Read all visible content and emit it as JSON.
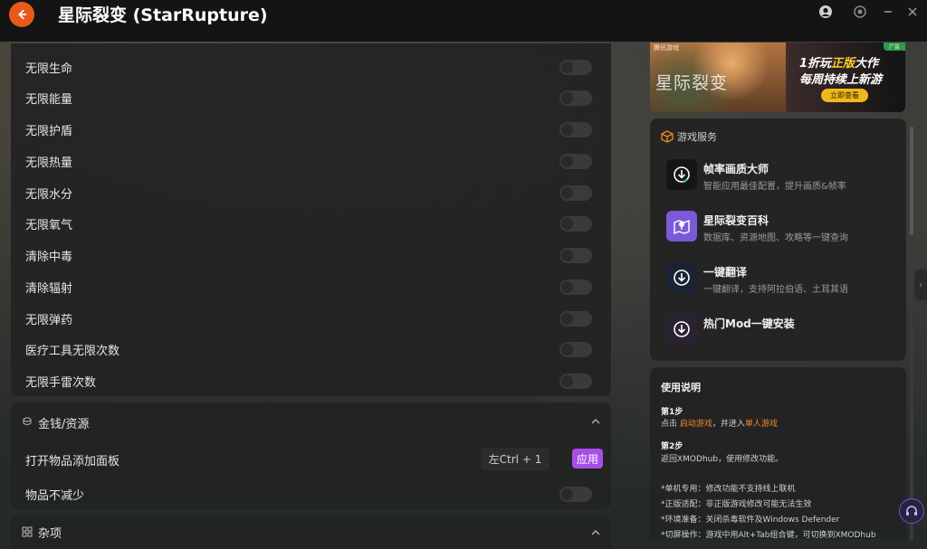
{
  "header": {
    "title": "星际裂变 (StarRupture)"
  },
  "cheats": {
    "items": [
      {
        "label": "无限生命"
      },
      {
        "label": "无限能量"
      },
      {
        "label": "无限护盾"
      },
      {
        "label": "无限热量"
      },
      {
        "label": "无限水分"
      },
      {
        "label": "无限氧气"
      },
      {
        "label": "清除中毒"
      },
      {
        "label": "清除辐射"
      },
      {
        "label": "无限弹药"
      },
      {
        "label": "医疗工具无限次数"
      },
      {
        "label": "无限手雷次数"
      }
    ]
  },
  "money_section": {
    "title": "金钱/资源",
    "open_panel_label": "打开物品添加面板",
    "hotkey": "左Ctrl + 1",
    "apply_label": "应用",
    "no_decrease_label": "物品不减少"
  },
  "misc_section": {
    "title": "杂项"
  },
  "banner": {
    "tag": "腾讯游戏",
    "game_name": "星际裂变",
    "promo_line1_a": "1折玩",
    "promo_line1_hl": "正版",
    "promo_line1_b": "大作",
    "promo_line2": "每周持续上新游",
    "button": "立即查看",
    "corner": "广告"
  },
  "services": {
    "title": "游戏服务",
    "items": [
      {
        "title": "帧率画质大师",
        "subtitle": "智能应用最佳配置，提升画质&帧率",
        "icon": "download-icon"
      },
      {
        "title": "星际裂变百科",
        "subtitle": "数据库、资源地图、攻略等一键查询",
        "icon": "map-pin-icon"
      },
      {
        "title": "一键翻译",
        "subtitle": "一键翻译，支持阿拉伯语、土耳其语",
        "icon": "download-icon"
      },
      {
        "title": "热门Mod一键安装",
        "subtitle": "",
        "icon": "download-icon"
      }
    ]
  },
  "usage": {
    "title": "使用说明",
    "step1_title": "第1步",
    "step1_a": "点击 ",
    "step1_link1": "启动游戏",
    "step1_b": "，并进入",
    "step1_link2": "单人游戏",
    "step2_title": "第2步",
    "step2_text": "返回XMODhub，使用修改功能。",
    "note1": "*单机专用：修改功能不支持线上联机",
    "note2": "*正版适配：非正版游戏修改可能无法生效",
    "note3": "*环境准备：关闭杀毒软件及Windows Defender",
    "note4": "*切屏操作：游戏中用Alt+Tab组合键，可切换到XMODhub"
  },
  "colors": {
    "accent_orange": "#e85a1a",
    "apply_purple": "#a84ee8",
    "link_orange": "#f08a24"
  }
}
